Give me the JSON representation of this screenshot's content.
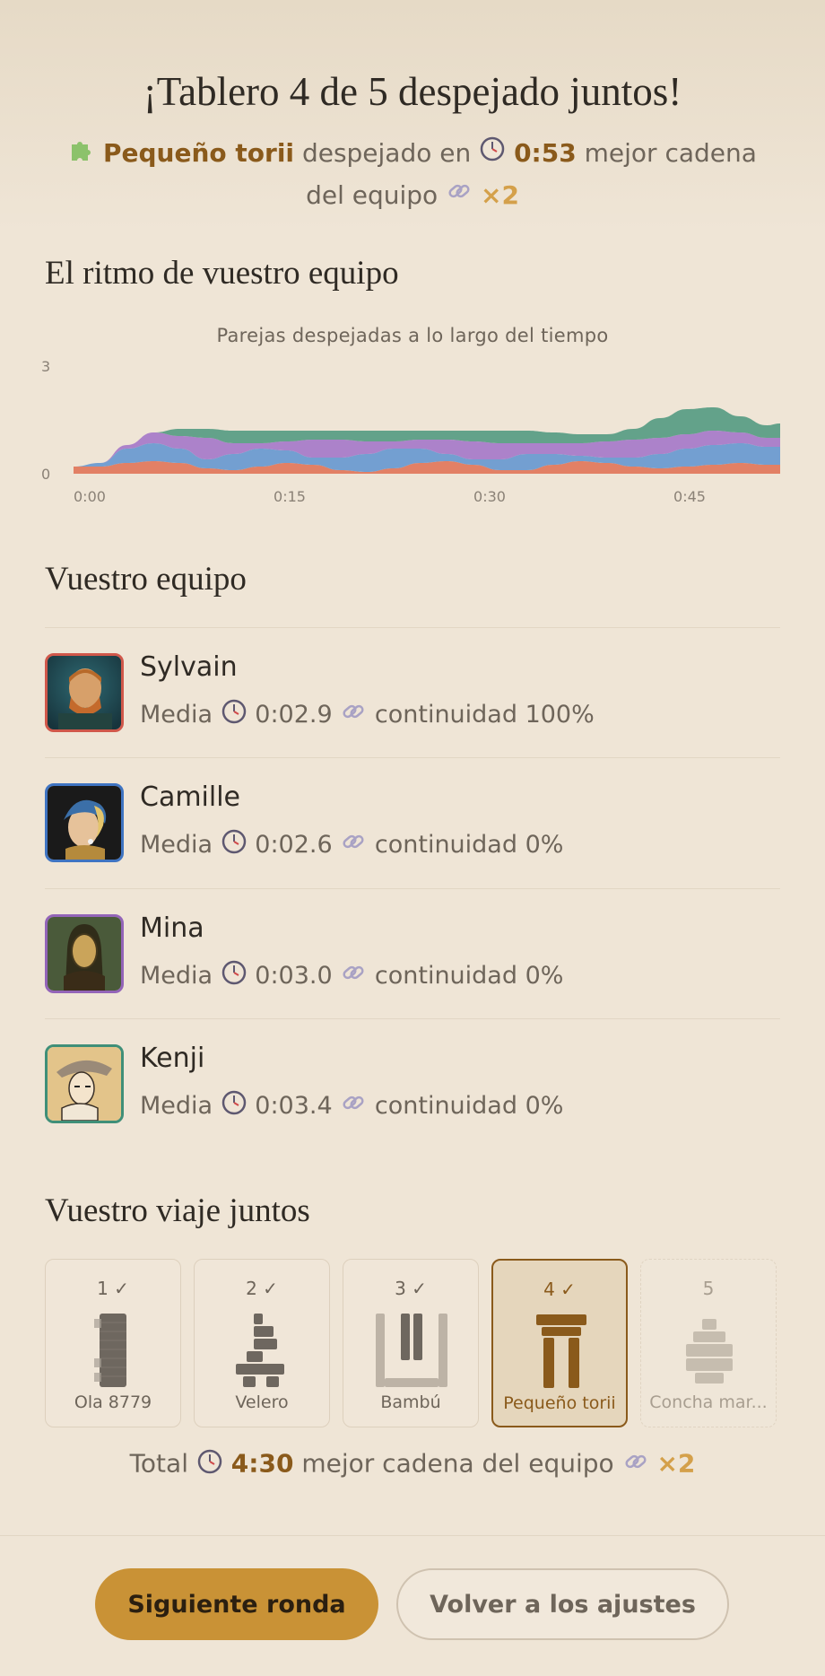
{
  "header": {
    "title": "¡Tablero 4 de 5 despejado juntos!",
    "board_name": "Pequeño torii",
    "cleared_in": "despejado en",
    "time": "0:53",
    "best_chain_label_1": "mejor cadena",
    "best_chain_label_2": "del equipo",
    "multiplier": "×2"
  },
  "rhythm": {
    "heading": "El ritmo de vuestro equipo",
    "chart_title": "Parejas despejadas a lo largo del tiempo"
  },
  "chart_data": {
    "type": "area",
    "title": "Parejas despejadas a lo largo del tiempo",
    "x_ticks": [
      "0:00",
      "0:15",
      "0:30",
      "0:45"
    ],
    "y_ticks": [
      "0",
      "3"
    ],
    "ylim": [
      0,
      3
    ],
    "xlim_seconds": [
      0,
      53
    ],
    "stacked": true,
    "x": [
      0,
      2,
      4,
      6,
      8,
      10,
      12,
      14,
      16,
      18,
      20,
      22,
      24,
      26,
      28,
      30,
      32,
      34,
      36,
      38,
      40,
      42,
      44,
      46,
      48,
      50,
      52,
      53
    ],
    "series": [
      {
        "color": "#e07a5f",
        "values": [
          0.2,
          0.2,
          0.3,
          0.35,
          0.3,
          0.15,
          0.1,
          0.2,
          0.3,
          0.25,
          0.1,
          0.05,
          0.15,
          0.3,
          0.35,
          0.25,
          0.1,
          0.1,
          0.25,
          0.35,
          0.3,
          0.2,
          0.15,
          0.2,
          0.25,
          0.3,
          0.25,
          0.25
        ]
      },
      {
        "color": "#6b9bd1",
        "values": [
          0.0,
          0.1,
          0.4,
          0.5,
          0.4,
          0.25,
          0.45,
          0.5,
          0.35,
          0.2,
          0.35,
          0.5,
          0.55,
          0.4,
          0.2,
          0.15,
          0.3,
          0.45,
          0.3,
          0.15,
          0.15,
          0.25,
          0.4,
          0.5,
          0.55,
          0.55,
          0.5,
          0.5
        ]
      },
      {
        "color": "#a87cc9",
        "values": [
          0.0,
          0.0,
          0.1,
          0.3,
          0.35,
          0.6,
          0.3,
          0.15,
          0.25,
          0.5,
          0.5,
          0.35,
          0.2,
          0.25,
          0.4,
          0.5,
          0.45,
          0.3,
          0.3,
          0.35,
          0.45,
          0.5,
          0.45,
          0.4,
          0.4,
          0.3,
          0.25,
          0.25
        ]
      },
      {
        "color": "#5b9e86",
        "values": [
          0.0,
          0.0,
          0.0,
          0.0,
          0.2,
          0.25,
          0.35,
          0.35,
          0.3,
          0.25,
          0.25,
          0.3,
          0.3,
          0.25,
          0.25,
          0.3,
          0.35,
          0.35,
          0.3,
          0.25,
          0.2,
          0.3,
          0.55,
          0.7,
          0.65,
          0.45,
          0.35,
          0.4
        ]
      }
    ]
  },
  "team": {
    "heading": "Vuestro equipo",
    "members": [
      {
        "name": "Sylvain",
        "media_label": "Media",
        "avg": "0:02.9",
        "continuity": "continuidad 100%",
        "color": "#d0574a"
      },
      {
        "name": "Camille",
        "media_label": "Media",
        "avg": "0:02.6",
        "continuity": "continuidad 0%",
        "color": "#3f74c2"
      },
      {
        "name": "Mina",
        "media_label": "Media",
        "avg": "0:03.0",
        "continuity": "continuidad 0%",
        "color": "#9364b8"
      },
      {
        "name": "Kenji",
        "media_label": "Media",
        "avg": "0:03.4",
        "continuity": "continuidad 0%",
        "color": "#3f8f78"
      }
    ]
  },
  "journey": {
    "heading": "Vuestro viaje juntos",
    "boards": [
      {
        "num": "1 ✓",
        "name": "Ola 8779",
        "state": "done"
      },
      {
        "num": "2 ✓",
        "name": "Velero",
        "state": "done"
      },
      {
        "num": "3 ✓",
        "name": "Bambú",
        "state": "done"
      },
      {
        "num": "4 ✓",
        "name": "Pequeño torii",
        "state": "current"
      },
      {
        "num": "5",
        "name": "Concha mar...",
        "state": "pending"
      }
    ]
  },
  "total": {
    "label": "Total",
    "time": "4:30",
    "best_chain": "mejor cadena del equipo",
    "multiplier": "×2"
  },
  "actions": {
    "next": "Siguiente ronda",
    "back": "Volver a los ajustes"
  },
  "icons": {
    "puzzle": "puzzle-icon",
    "clock": "clock-icon",
    "link": "link-icon"
  }
}
